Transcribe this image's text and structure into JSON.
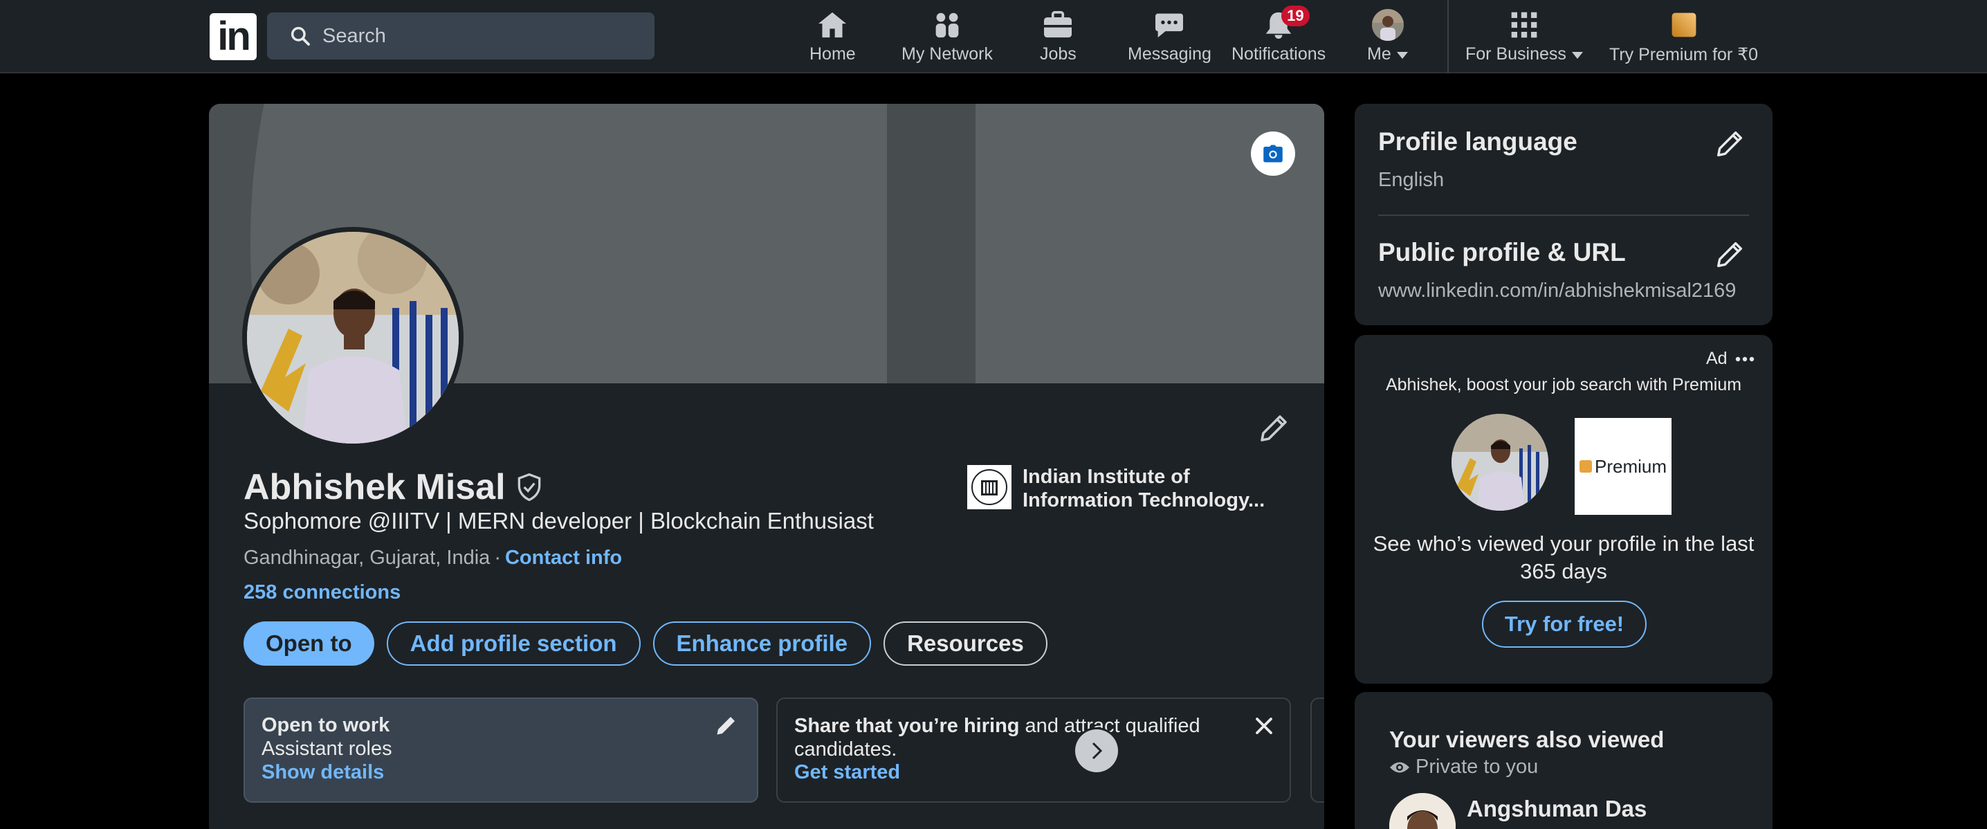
{
  "nav": {
    "search_placeholder": "Search",
    "items": [
      {
        "label": "Home",
        "icon": "home-icon"
      },
      {
        "label": "My Network",
        "icon": "network-icon"
      },
      {
        "label": "Jobs",
        "icon": "briefcase-icon"
      },
      {
        "label": "Messaging",
        "icon": "chat-icon"
      },
      {
        "label": "Notifications",
        "icon": "bell-icon",
        "badge": "19"
      },
      {
        "label": "Me",
        "icon": "avatar"
      },
      {
        "label": "For Business",
        "icon": "grid-icon"
      },
      {
        "label": "Try Premium for ₹0",
        "icon": "premium-icon"
      }
    ]
  },
  "profile": {
    "name": "Abhishek Misal",
    "headline": "Sophomore @IIITV | MERN developer | Blockchain Enthusiast",
    "location": "Gandhinagar, Gujarat, India",
    "location_sep": "·",
    "contact_info": "Contact info",
    "connections": "258 connections",
    "education": "Indian Institute of Information Technology...",
    "buttons": {
      "open_to": "Open to",
      "add_section": "Add profile section",
      "enhance": "Enhance profile",
      "resources": "Resources"
    },
    "open_to_work": {
      "title": "Open to work",
      "roles": "Assistant roles",
      "link": "Show details"
    },
    "hiring": {
      "bold": "Share that you’re hiring",
      "rest": " and attract qualified candidates.",
      "link": "Get started"
    }
  },
  "rail": {
    "language_title": "Profile language",
    "language_value": "English",
    "url_title": "Public profile & URL",
    "url_value": "www.linkedin.com/in/abhishekmisal2169",
    "ad": {
      "label": "Ad",
      "tagline": "Abhishek, boost your job search with Premium",
      "premium_word": "Premium",
      "copy": "See who’s viewed your profile in the last 365 days",
      "cta": "Try for free!"
    },
    "viewers": {
      "title": "Your viewers also viewed",
      "private": "Private to you",
      "first_name": "Angshuman Das"
    }
  },
  "colors": {
    "accent": "#71b7fb",
    "card_bg": "#1d2226",
    "badge": "#cb112d"
  }
}
